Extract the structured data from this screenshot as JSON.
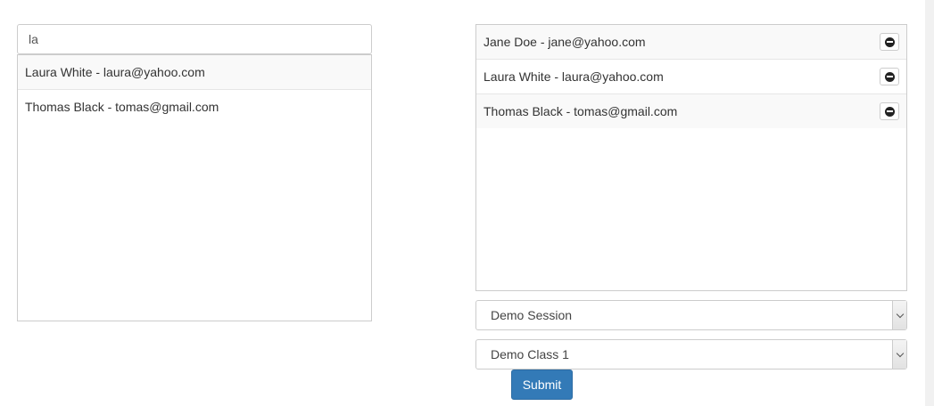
{
  "search": {
    "value": "la"
  },
  "results": [
    {
      "label": "Laura White - laura@yahoo.com"
    },
    {
      "label": "Thomas Black - tomas@gmail.com"
    }
  ],
  "selected": [
    {
      "label": "Jane Doe - jane@yahoo.com"
    },
    {
      "label": "Laura White - laura@yahoo.com"
    },
    {
      "label": "Thomas Black - tomas@gmail.com"
    }
  ],
  "session_select": {
    "value": "Demo Session"
  },
  "class_select": {
    "value": "Demo Class 1"
  },
  "submit": {
    "label": "Submit"
  },
  "colors": {
    "primary": "#337ab7",
    "border": "#cccccc",
    "row_alt": "#f9f9f9"
  },
  "icons": {
    "remove": "minus-circle-icon",
    "dropdown": "chevron-down-icon"
  }
}
